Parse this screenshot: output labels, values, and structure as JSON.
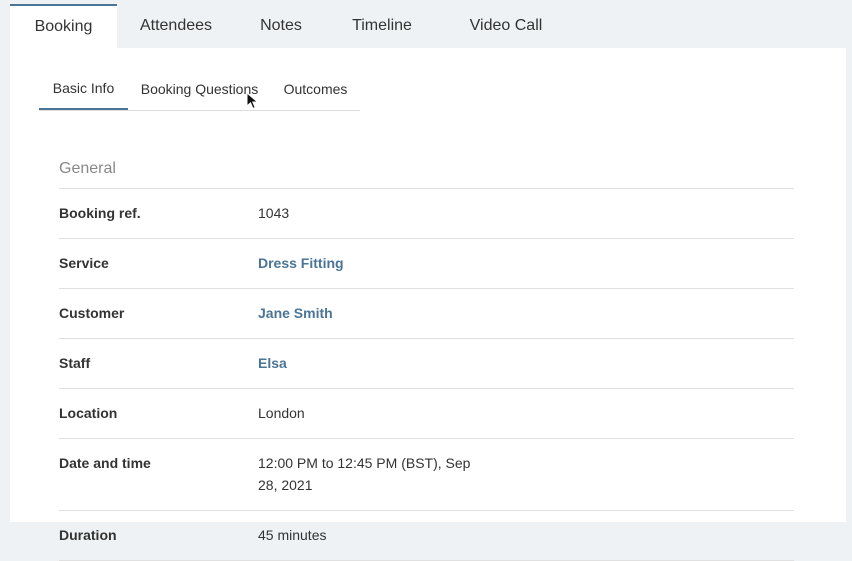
{
  "top_tabs": [
    {
      "label": "Booking",
      "active": true
    },
    {
      "label": "Attendees",
      "active": false
    },
    {
      "label": "Notes",
      "active": false
    },
    {
      "label": "Timeline",
      "active": false
    },
    {
      "label": "Video Call",
      "active": false
    }
  ],
  "sub_tabs": [
    {
      "label": "Basic Info",
      "active": true
    },
    {
      "label": "Booking Questions",
      "active": false
    },
    {
      "label": "Outcomes",
      "active": false
    }
  ],
  "section": {
    "title": "General",
    "rows": [
      {
        "label": "Booking ref.",
        "value": "1043"
      },
      {
        "label": "Service",
        "value": "Dress Fitting"
      },
      {
        "label": "Customer",
        "value": "Jane Smith"
      },
      {
        "label": "Staff",
        "value": "Elsa"
      },
      {
        "label": "Location",
        "value": "London"
      },
      {
        "label": "Date and time",
        "value": "12:00 PM to 12:45 PM (BST), Sep 28, 2021"
      },
      {
        "label": "Duration",
        "value": "45 minutes"
      }
    ]
  },
  "colors": {
    "accent": "#4a7597",
    "link": "#4a7597"
  },
  "icons": {
    "cursor": "mouse-pointer-icon"
  }
}
